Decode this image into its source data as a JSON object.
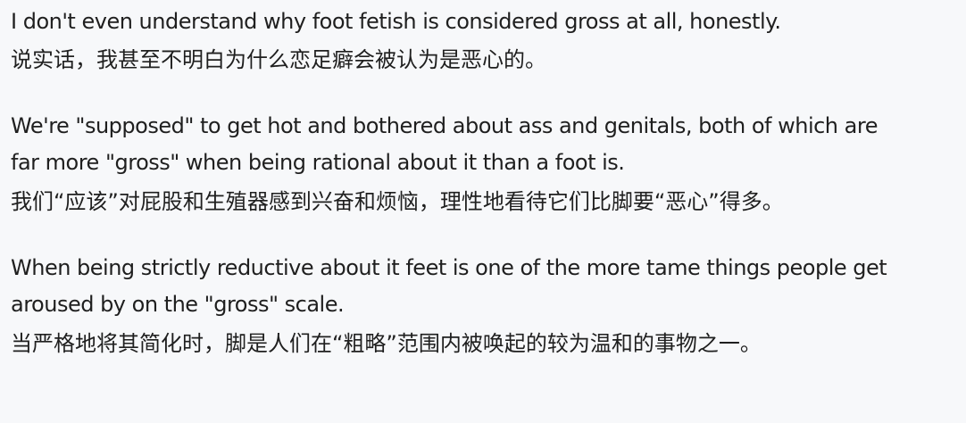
{
  "paragraphs": [
    {
      "english": [
        "I don't even understand why foot fetish is considered gross at all, honestly."
      ],
      "chinese": "说实话，我甚至不明白为什么恋足癖会被认为是恶心的。"
    },
    {
      "english": [
        "We're \"supposed\" to get hot and bothered about ass and genitals, both of which are",
        "far more \"gross\" when being rational about it than a foot is."
      ],
      "chinese": "我们“应该”对屁股和生殖器感到兴奋和烦恼，理性地看待它们比脚要“恶心”得多。"
    },
    {
      "english": [
        "When being strictly reductive about it feet is one of the more tame things people get",
        "aroused by on the \"gross\" scale."
      ],
      "chinese": "当严格地将其简化时，脚是人们在“粗略”范围内被唤起的较为温和的事物之一。"
    }
  ]
}
